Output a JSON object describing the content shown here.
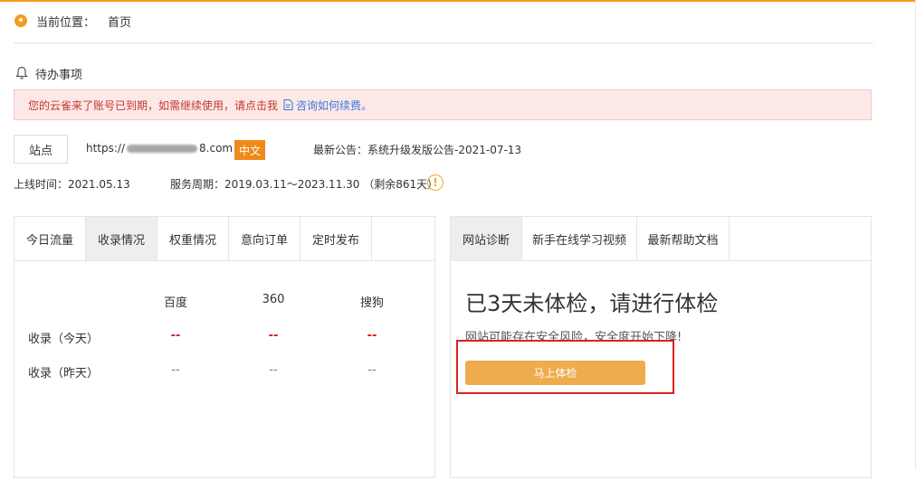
{
  "breadcrumb": {
    "label": "当前位置：",
    "current": "首页"
  },
  "todo": {
    "title": "待办事项"
  },
  "alert": {
    "message": "您的云雀来了账号已到期，如需继续使用，请点击我",
    "link": "咨询如何续费。"
  },
  "site": {
    "button": "站点",
    "url_prefix": "https://",
    "url_suffix": "8.com",
    "language": "中文",
    "notice": "最新公告：系统升级发版公告-2021-07-13",
    "online_time": "上线时间：2021.05.13",
    "service_period": "服务周期：2019.03.11～2023.11.30 （剩余861天）",
    "warn_glyph": "!"
  },
  "left_panel": {
    "tabs": [
      "今日流量",
      "收录情况",
      "权重情况",
      "意向订单",
      "定时发布"
    ],
    "active_tab": 1,
    "columns": [
      "百度",
      "360",
      "搜狗"
    ],
    "rows": [
      {
        "label": "收录（今天）",
        "values": [
          "--",
          "--",
          "--"
        ]
      },
      {
        "label": "收录（昨天）",
        "values": [
          "--",
          "--",
          "--"
        ]
      }
    ]
  },
  "right_panel": {
    "tabs": [
      "网站诊断",
      "新手在线学习视频",
      "最新帮助文档"
    ],
    "active_tab": 0,
    "title": "已3天未体检，请进行体检",
    "subtitle": "网站可能存在安全风险，安全度开始下降!",
    "button": "马上体检"
  },
  "colors": {
    "accent": "#f39c1f",
    "alert_text": "#c0392b",
    "link": "#3a78d9",
    "button": "#efac4c",
    "highlight": "#e02020"
  }
}
